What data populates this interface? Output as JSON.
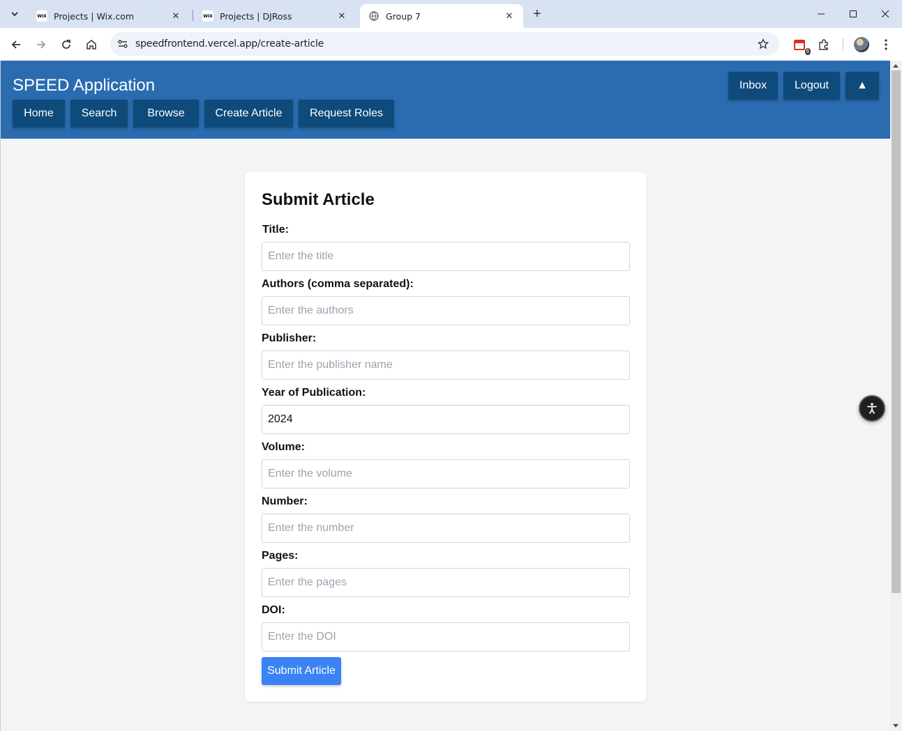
{
  "browser": {
    "tabs": [
      {
        "favicon": "wix",
        "label": "Projects | Wix.com"
      },
      {
        "favicon": "wix",
        "label": "Projects | DJRoss"
      },
      {
        "favicon": "globe-icon",
        "label": "Group 7"
      }
    ],
    "favicon_wix_text": "WIX",
    "url": "speedfrontend.vercel.app/create-article",
    "extension_badge": "6"
  },
  "app": {
    "title": "SPEED Application",
    "nav": [
      "Home",
      "Search",
      "Browse",
      "Create Article",
      "Request Roles"
    ],
    "header_buttons": {
      "inbox": "Inbox",
      "logout": "Logout",
      "toggle": "▲"
    }
  },
  "form": {
    "heading": "Submit Article",
    "fields": [
      {
        "label": "Title:",
        "placeholder": "Enter the title",
        "value": ""
      },
      {
        "label": "Authors (comma separated):",
        "placeholder": "Enter the authors",
        "value": ""
      },
      {
        "label": "Publisher:",
        "placeholder": "Enter the publisher name",
        "value": ""
      },
      {
        "label": "Year of Publication:",
        "placeholder": "",
        "value": "2024"
      },
      {
        "label": "Volume:",
        "placeholder": "Enter the volume",
        "value": ""
      },
      {
        "label": "Number:",
        "placeholder": "Enter the number",
        "value": ""
      },
      {
        "label": "Pages:",
        "placeholder": "Enter the pages",
        "value": ""
      },
      {
        "label": "DOI:",
        "placeholder": "Enter the DOI",
        "value": ""
      }
    ],
    "submit_label": "Submit Article"
  },
  "colors": {
    "header_bg": "#2b6cb0",
    "nav_button_bg": "#0e4a7a",
    "submit_bg": "#3b82f6",
    "page_bg": "#f3f4f6"
  }
}
